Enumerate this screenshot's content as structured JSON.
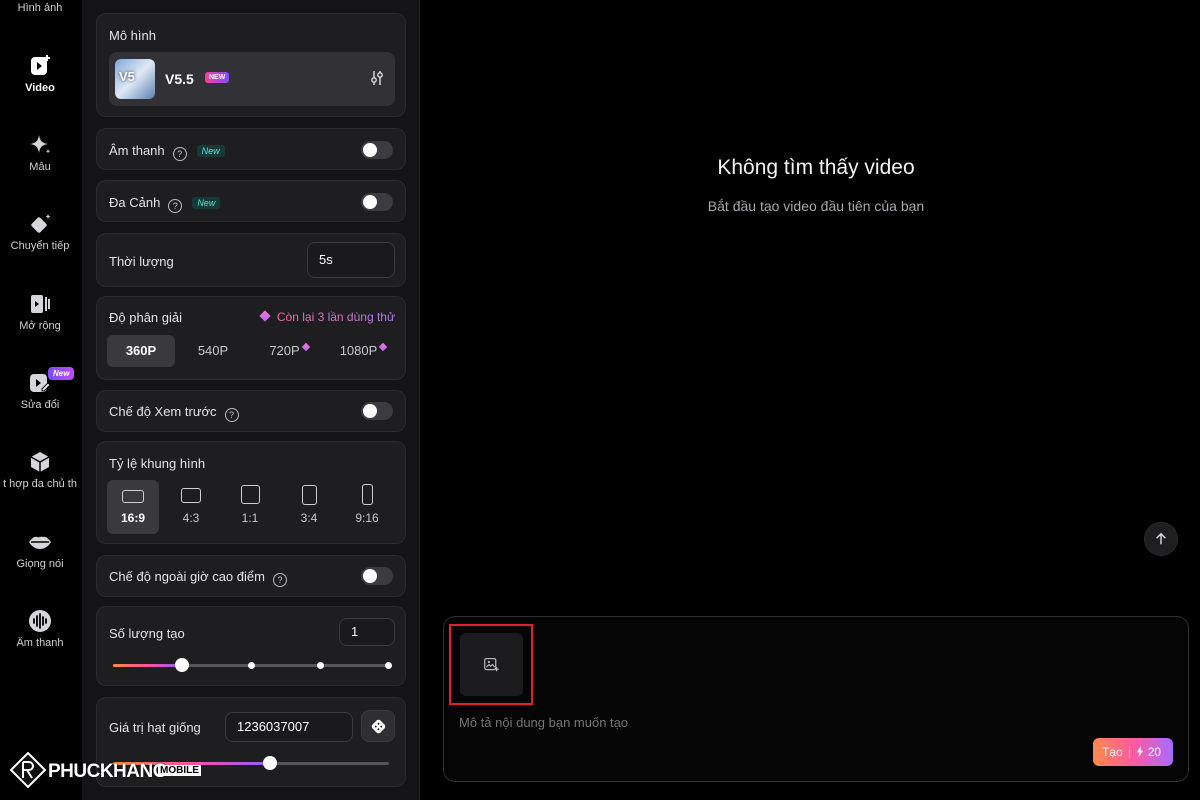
{
  "nav": {
    "items": [
      {
        "label": "Hình ảnh",
        "icon": "image-icon"
      },
      {
        "label": "Video",
        "icon": "video-plus-icon"
      },
      {
        "label": "Mẫu",
        "icon": "sparkle-icon"
      },
      {
        "label": "Chuyển tiếp",
        "icon": "transition-icon"
      },
      {
        "label": "Mở rộng",
        "icon": "extend-icon"
      },
      {
        "label": "Sửa đổi",
        "icon": "edit-video-icon",
        "badge": "New"
      },
      {
        "label": "t hợp đa chủ th",
        "icon": "cube-icon"
      },
      {
        "label": "Giọng nói",
        "icon": "lips-icon"
      },
      {
        "label": "Âm thanh",
        "icon": "audio-wave-icon"
      }
    ]
  },
  "panel": {
    "model": {
      "label": "Mô hình",
      "name": "V5.5",
      "thumb_text": "V5",
      "new_tag": "NEW"
    },
    "audio": {
      "label": "Âm thanh",
      "new_tag": "New",
      "enabled": false
    },
    "multi_scene": {
      "label": "Đa Cảnh",
      "new_tag": "New",
      "enabled": false
    },
    "duration": {
      "label": "Thời lượng",
      "value": "5s"
    },
    "resolution": {
      "label": "Độ phân giải",
      "quota": "Còn lại 3 lần dùng thử",
      "options": [
        "360P",
        "540P",
        "720P",
        "1080P"
      ],
      "selected": "360P"
    },
    "preview_mode": {
      "label": "Chế độ Xem trước",
      "enabled": false
    },
    "aspect_ratio": {
      "label": "Tỷ lệ khung hình",
      "options": [
        "16:9",
        "4:3",
        "1:1",
        "3:4",
        "9:16"
      ],
      "selected": "16:9"
    },
    "off_peak": {
      "label": "Chế độ ngoài giờ cao điểm",
      "enabled": false
    },
    "quantity": {
      "label": "Số lượng tạo",
      "value": "1",
      "slider_level": 0.25
    },
    "seed": {
      "label": "Giá trị hạt giống",
      "value": "1236037007",
      "slider_level": 0.57
    }
  },
  "main": {
    "empty_title": "Không tìm thấy video",
    "empty_subtitle": "Bắt đầu tạo video đầu tiên của bạn",
    "prompt_placeholder": "Mô tả nội dung bạn muốn tạo",
    "generate": {
      "label": "Tạo",
      "cost": "20"
    }
  },
  "watermark": {
    "text": "PHUCKHANG",
    "suffix": "MOBILE"
  },
  "colors": {
    "accent_pink": "#ff5aa0",
    "accent_orange": "#ff8a4a",
    "accent_purple": "#a66bff",
    "highlight_red": "#e0202a"
  }
}
